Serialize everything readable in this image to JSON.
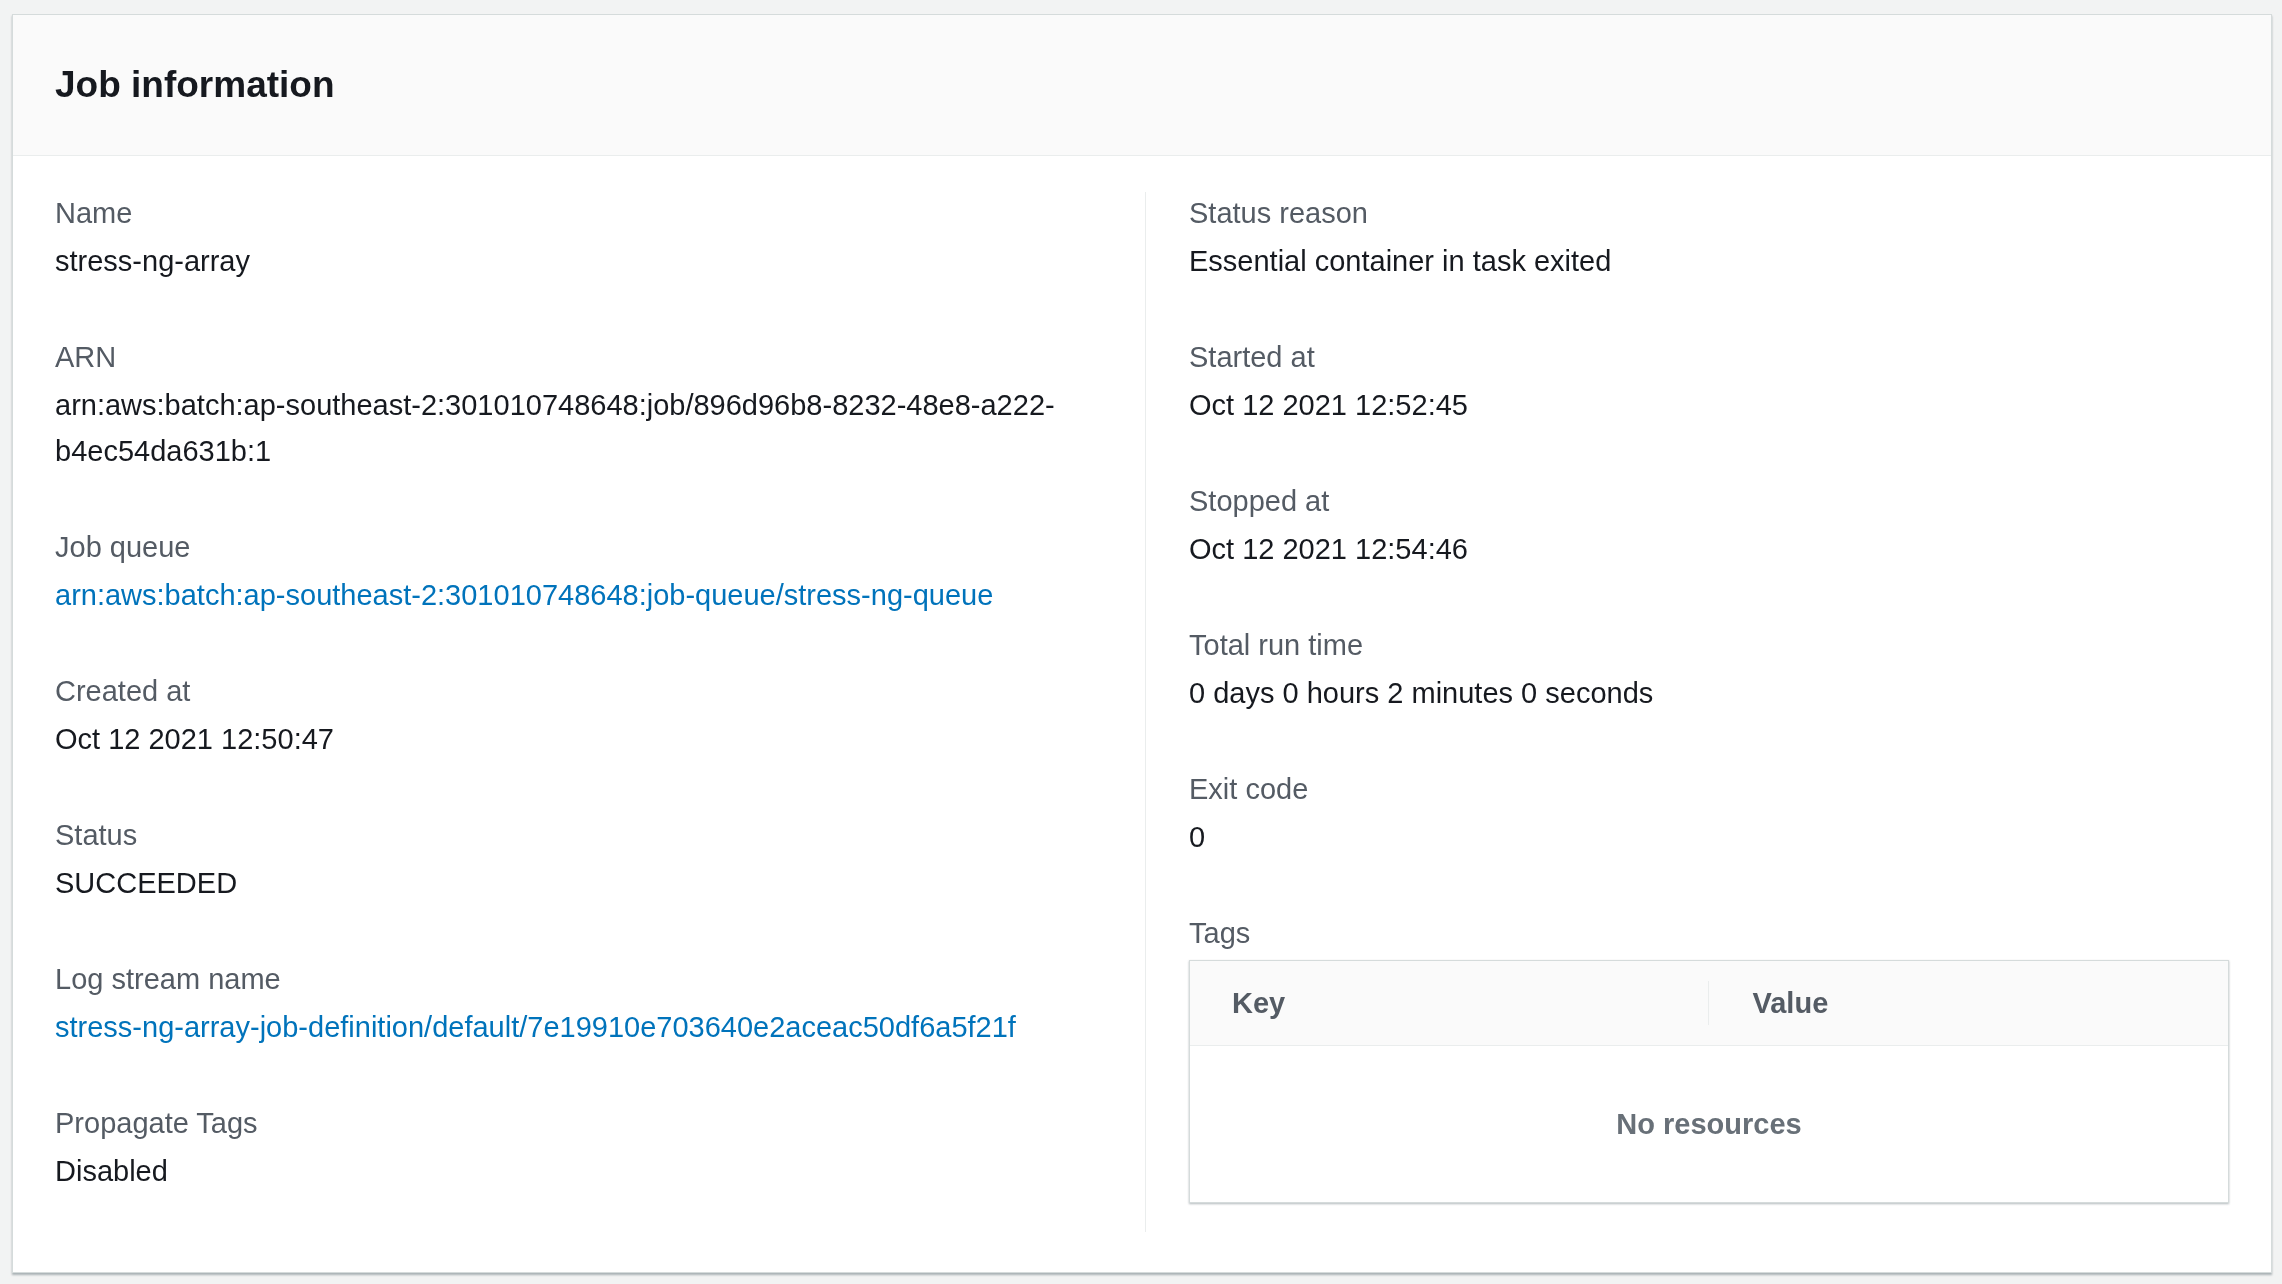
{
  "panel": {
    "title": "Job information"
  },
  "left_fields": [
    {
      "label": "Name",
      "value": "stress-ng-array",
      "kind": "text"
    },
    {
      "label": "ARN",
      "value": "arn:aws:batch:ap-southeast-2:301010748648:job/896d96b8-8232-48e8-a222-b4ec54da631b:1",
      "kind": "text"
    },
    {
      "label": "Job queue",
      "value": "arn:aws:batch:ap-southeast-2:301010748648:job-queue/stress-ng-queue",
      "kind": "link"
    },
    {
      "label": "Created at",
      "value": "Oct 12 2021 12:50:47",
      "kind": "text"
    },
    {
      "label": "Status",
      "value": "SUCCEEDED",
      "kind": "text"
    },
    {
      "label": "Log stream name",
      "value": "stress-ng-array-job-definition/default/7e19910e703640e2aceac50df6a5f21f",
      "kind": "link"
    },
    {
      "label": "Propagate Tags",
      "value": "Disabled",
      "kind": "text"
    }
  ],
  "right_fields": [
    {
      "label": "Status reason",
      "value": "Essential container in task exited",
      "kind": "text"
    },
    {
      "label": "Started at",
      "value": "Oct 12 2021 12:52:45",
      "kind": "text"
    },
    {
      "label": "Stopped at",
      "value": "Oct 12 2021 12:54:46",
      "kind": "text"
    },
    {
      "label": "Total run time",
      "value": "0 days 0 hours 2 minutes 0 seconds",
      "kind": "text"
    },
    {
      "label": "Exit code",
      "value": "0",
      "kind": "text"
    }
  ],
  "tags": {
    "label": "Tags",
    "columns": [
      "Key",
      "Value"
    ],
    "empty_text": "No resources"
  }
}
